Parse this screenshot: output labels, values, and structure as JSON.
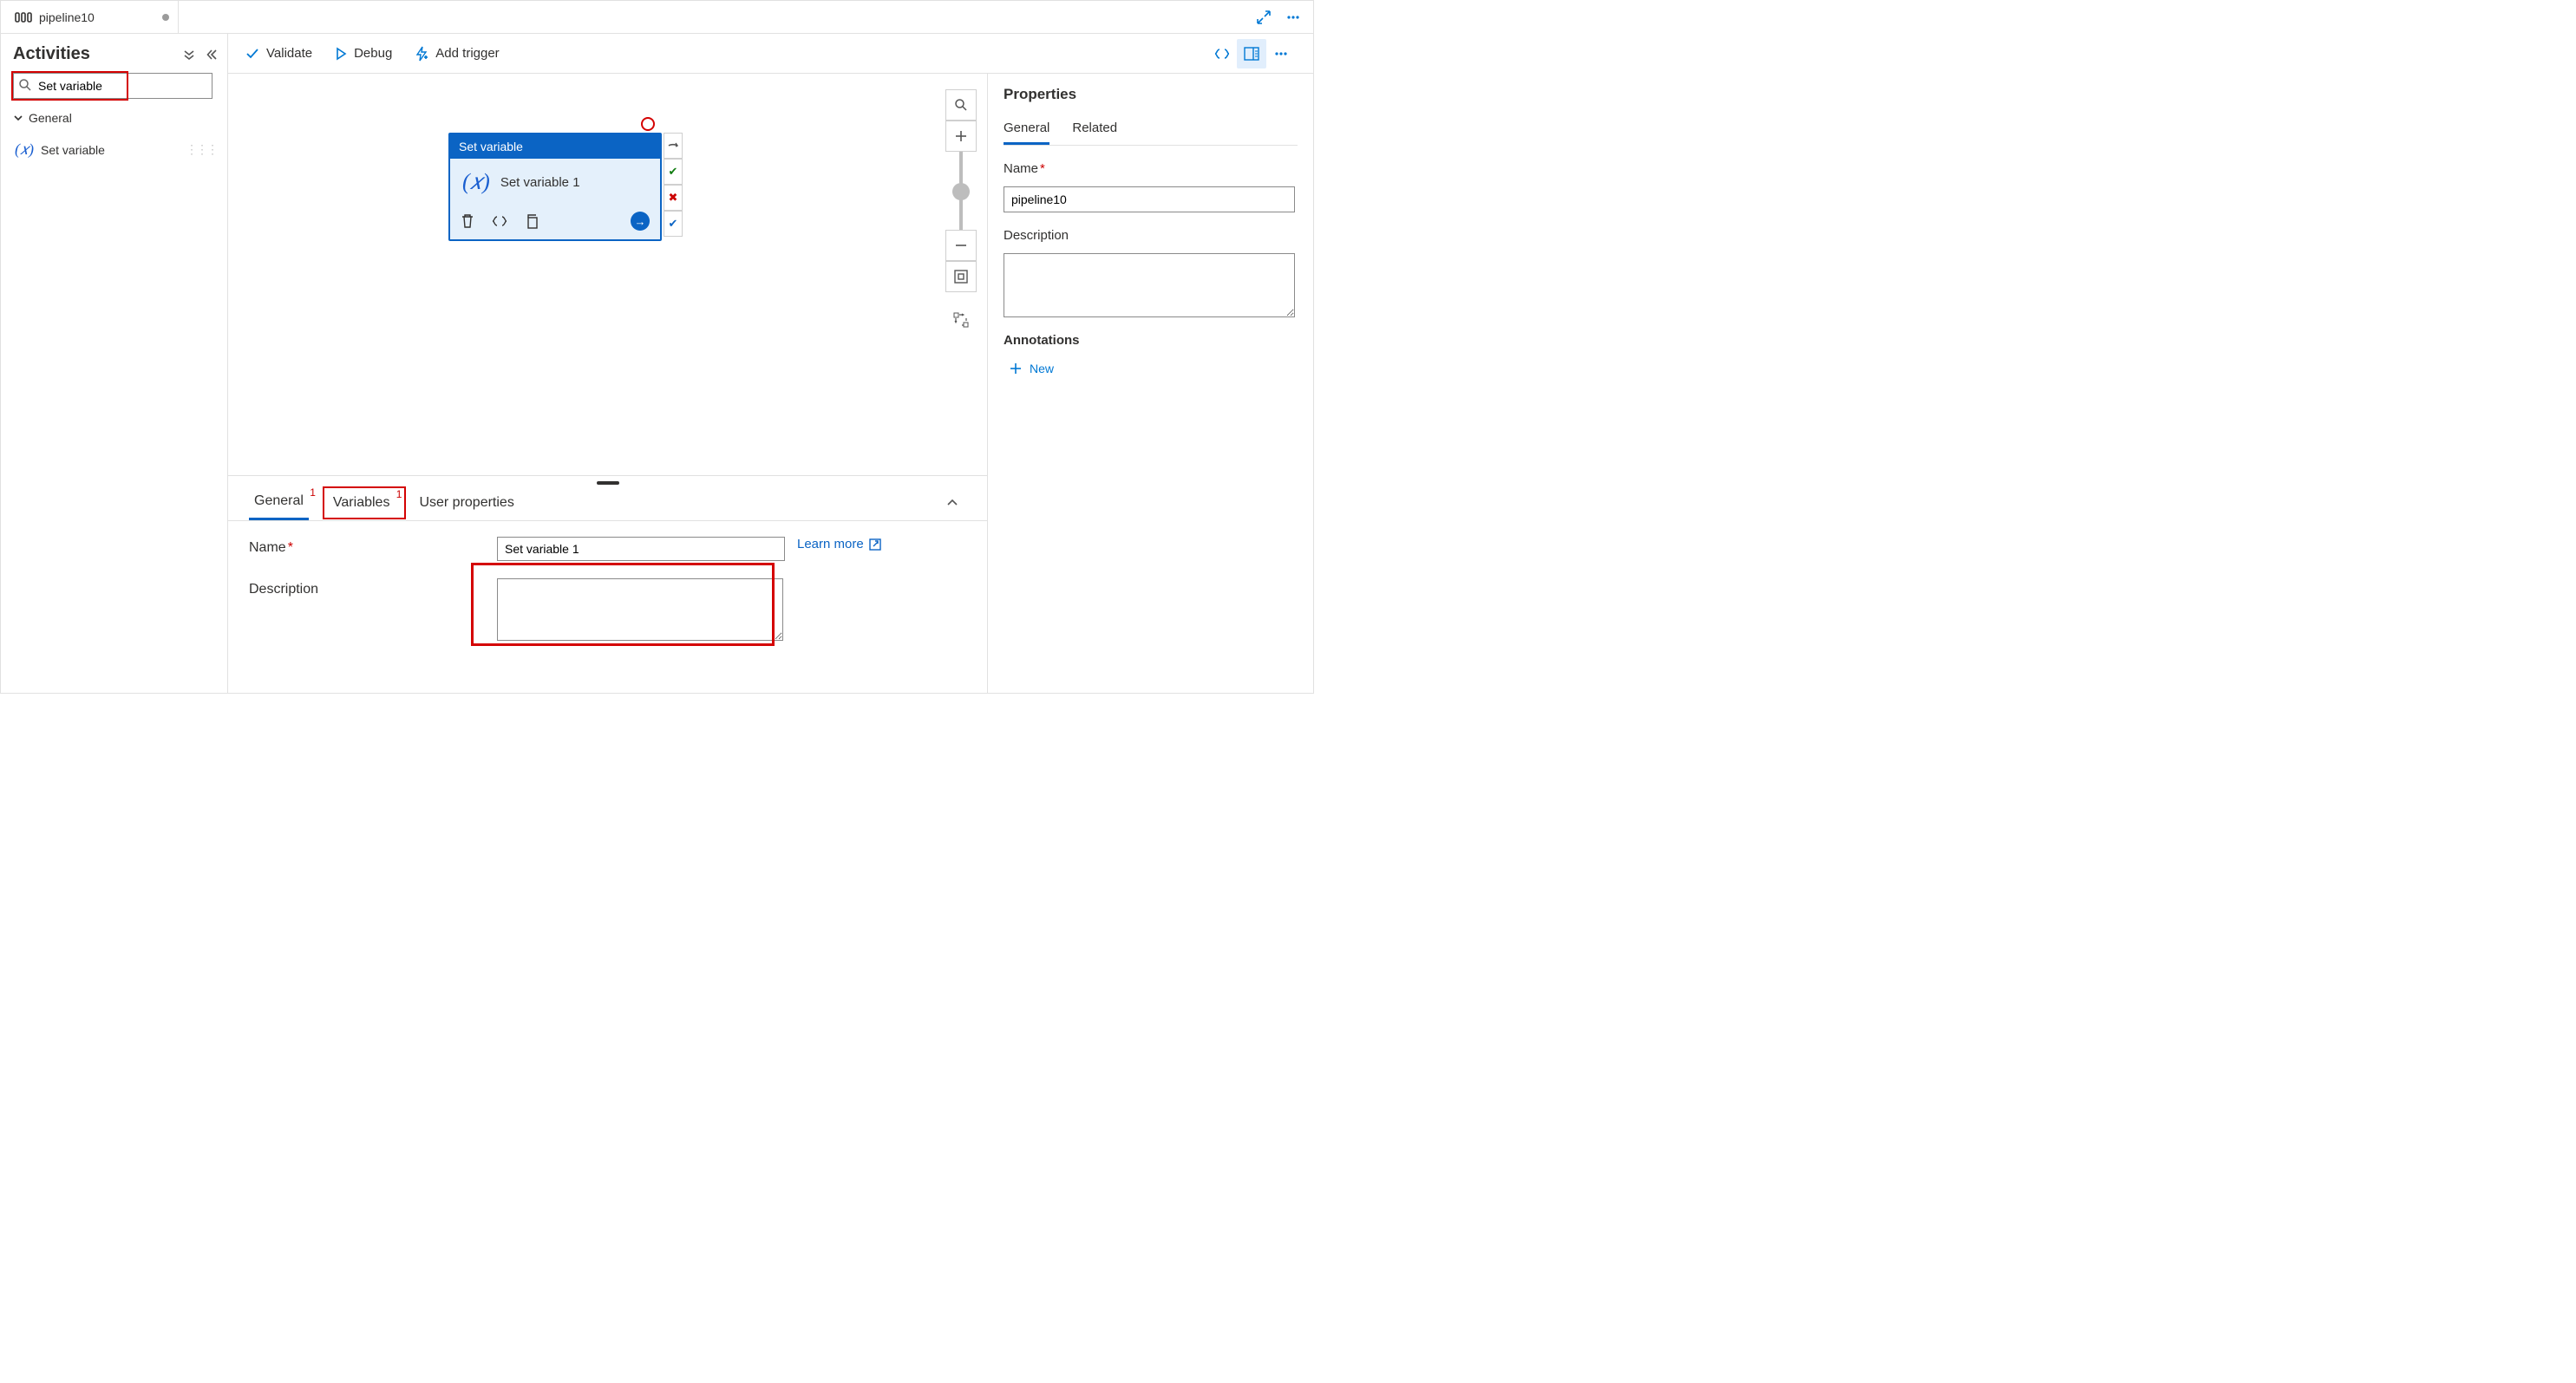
{
  "tab": {
    "title": "pipeline10"
  },
  "sidebar": {
    "title": "Activities",
    "search_value": "Set variable",
    "section": "General",
    "activity": "Set variable"
  },
  "toolbar": {
    "validate": "Validate",
    "debug": "Debug",
    "add_trigger": "Add trigger"
  },
  "node": {
    "type_label": "Set variable",
    "name": "Set variable 1"
  },
  "bottom": {
    "tabs": {
      "general": "General",
      "variables": "Variables",
      "user_props": "User properties",
      "badge": "1"
    },
    "name_label": "Name",
    "name_value": "Set variable 1",
    "learn_more": "Learn more",
    "desc_label": "Description",
    "desc_value": ""
  },
  "props": {
    "title": "Properties",
    "tabs": {
      "general": "General",
      "related": "Related"
    },
    "name_label": "Name",
    "name_value": "pipeline10",
    "desc_label": "Description",
    "desc_value": "",
    "annotations_label": "Annotations",
    "new_label": "New"
  }
}
